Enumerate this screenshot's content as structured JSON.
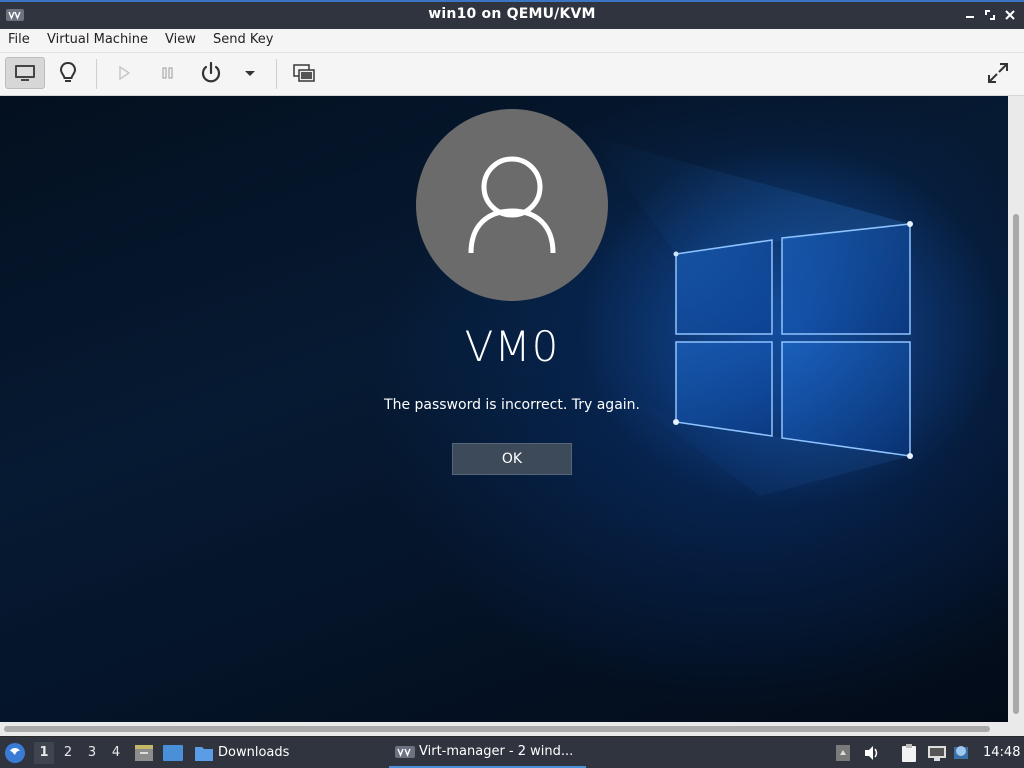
{
  "window": {
    "title": "win10 on QEMU/KVM",
    "controls": [
      "minimize",
      "maximize",
      "close"
    ]
  },
  "menu": {
    "items": [
      "File",
      "Virtual Machine",
      "View",
      "Send Key"
    ]
  },
  "toolbar": {
    "buttons": [
      "console-icon",
      "lightbulb-icon",
      "play-icon",
      "pause-icon",
      "power-icon",
      "dropdown-icon",
      "snapshot-icon",
      "fullscreen-icon"
    ]
  },
  "vm_screen": {
    "username": "VM0",
    "message": "The password is incorrect. Try again.",
    "ok_label": "OK"
  },
  "taskbar": {
    "workspaces": [
      "1",
      "2",
      "3",
      "4"
    ],
    "active_workspace": "1",
    "folder_label": "Downloads",
    "active_task": "Virt-manager - 2 wind...",
    "clock": "14:48"
  },
  "colors": {
    "titlebar": "#2f343f",
    "accent": "#4a90d9",
    "avatar_bg": "#6b6b6b",
    "ok_button": "#3d4a5a"
  }
}
